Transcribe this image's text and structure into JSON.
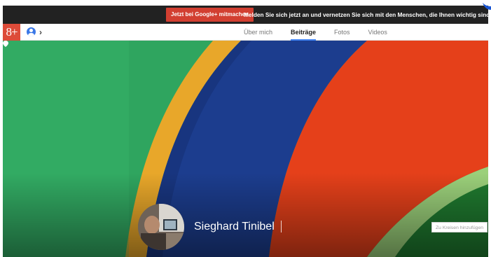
{
  "promo": {
    "join_button": "Jetzt bei Google+ mitmachen",
    "message": "Melden Sie sich jetzt an und vernetzen Sie sich mit den Menschen, die Ihnen wichtig sind."
  },
  "nav": {
    "logo_text": "8+",
    "chevron": "›",
    "tabs": [
      {
        "label": "Über mich",
        "active": false
      },
      {
        "label": "Beiträge",
        "active": true
      },
      {
        "label": "Fotos",
        "active": false
      },
      {
        "label": "Videos",
        "active": false
      }
    ]
  },
  "profile": {
    "name": "Sieghard Tinibel",
    "add_to_circles_button": "Zu Kreisen hinzufügen"
  },
  "icons": {
    "logo": "google-plus-icon",
    "account": "account-icon",
    "location": "location-pin-icon"
  },
  "colors": {
    "promo_bar": "#222222",
    "join_button": "#d23f31",
    "logo": "#dd4b39",
    "active_tab_underline": "#4285f4"
  }
}
